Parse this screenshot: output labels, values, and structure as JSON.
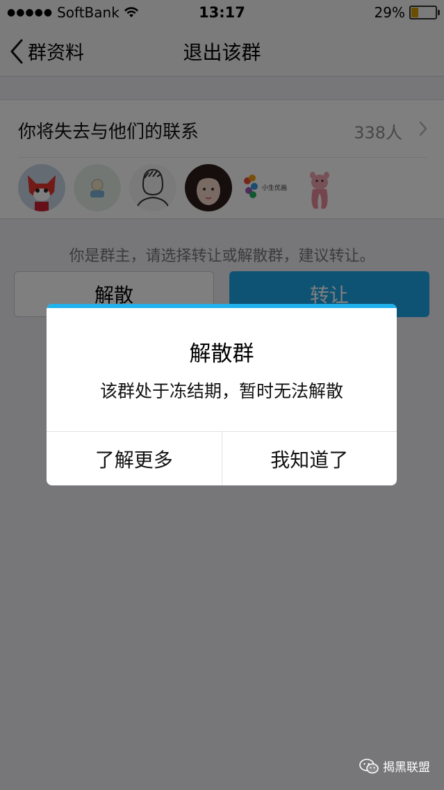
{
  "status_bar": {
    "signal": "●●●●●",
    "carrier": "SoftBank",
    "time": "13:17",
    "battery_percent": "29%",
    "battery_level": 0.29
  },
  "nav": {
    "back_label": "群资料",
    "title": "退出该群"
  },
  "members": {
    "label": "你将失去与他们的联系",
    "count": "338人",
    "avatars": [
      "fox-avatar",
      "cartoon-avatar",
      "sketch-avatar",
      "girl-avatar",
      "brand-avatar",
      "pink-panther-avatar"
    ],
    "brand_avatar_text": "小生优画"
  },
  "hint": "你是群主，请选择转让或解散群，建议转让。",
  "buttons": {
    "dissolve": "解散",
    "transfer": "转让"
  },
  "dialog": {
    "title": "解散群",
    "message": "该群处于冻结期，暂时无法解散",
    "learn_more": "了解更多",
    "ok": "我知道了"
  },
  "watermark": "揭黑联盟",
  "colors": {
    "accent": "#21b2ee",
    "transfer_button": "#1fa7e8",
    "battery": "#d89d00"
  }
}
